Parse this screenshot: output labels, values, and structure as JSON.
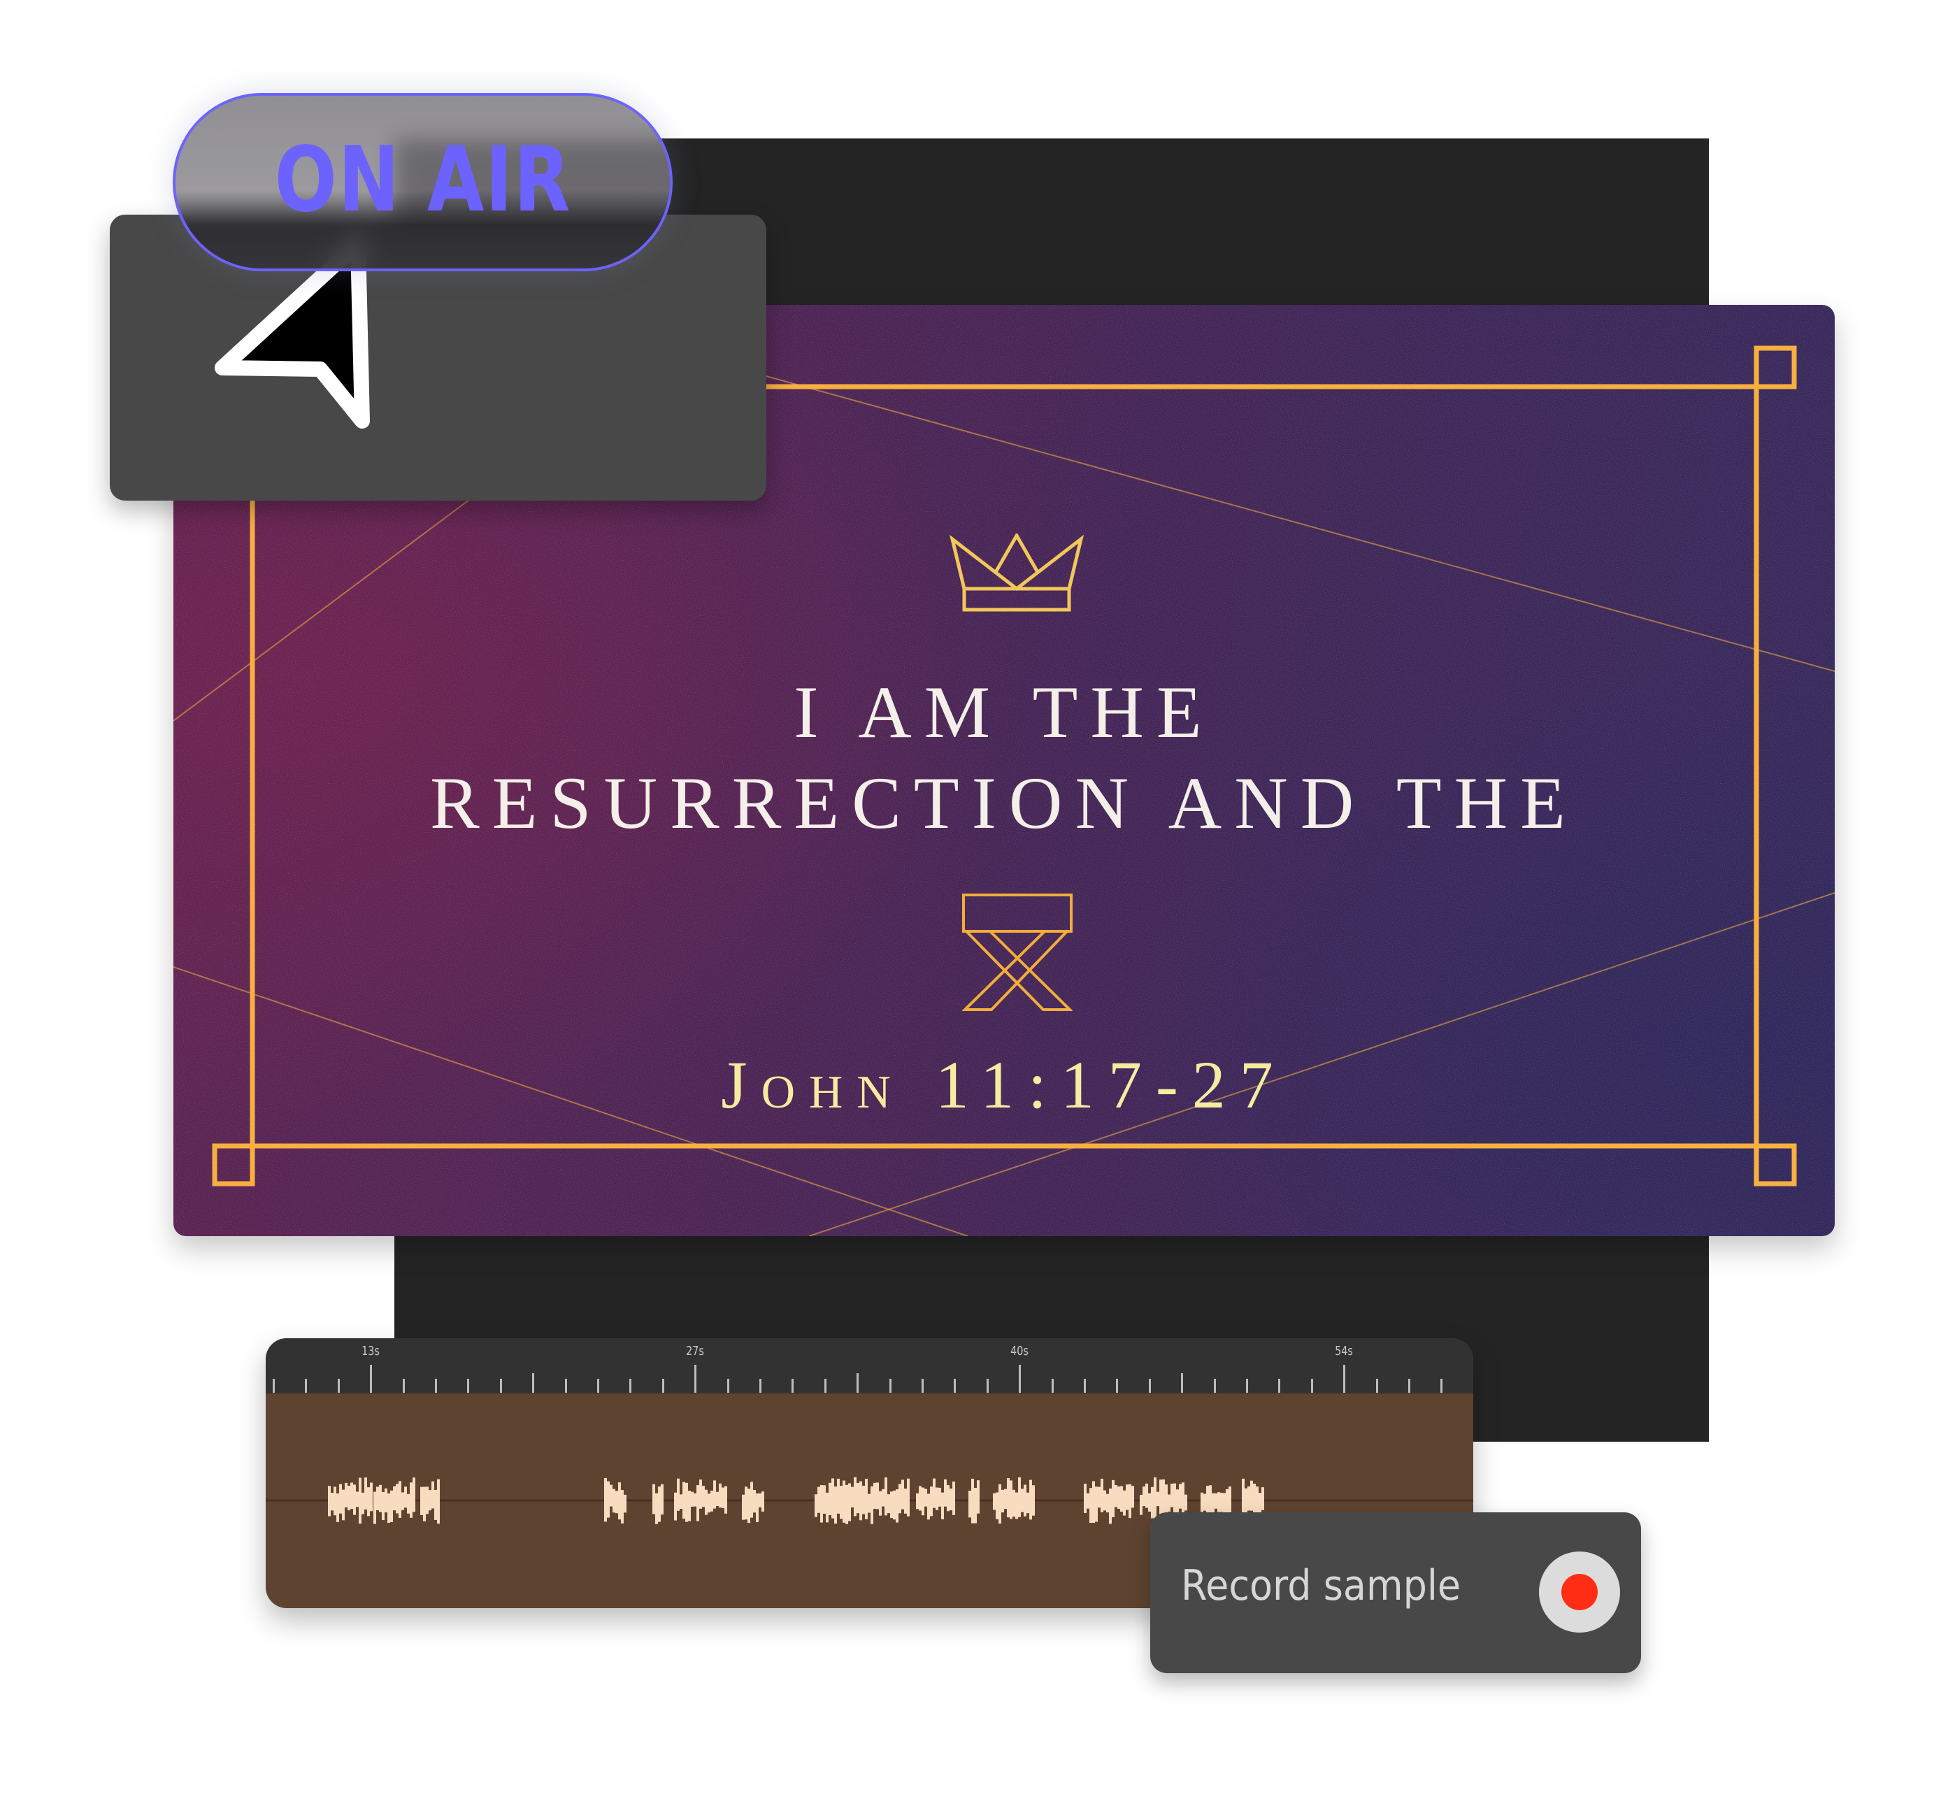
{
  "badge": {
    "label": "ON AIR",
    "color": "#6c63ff"
  },
  "slide": {
    "line1": "I AM THE",
    "line2": "RESURRECTION AND THE",
    "reference": "John 11:17-27",
    "icons": [
      "crown-icon",
      "manger-icon"
    ],
    "colors": {
      "gold": "#f7b040",
      "title": "#f4efe8",
      "reference": "#f6eca0",
      "left": "#5c2352",
      "right": "#33295c"
    }
  },
  "timeline": {
    "labels": [
      {
        "text": "13s",
        "tick": 3
      },
      {
        "text": "27s",
        "tick": 13
      },
      {
        "text": "40s",
        "tick": 23
      },
      {
        "text": "54s",
        "tick": 33
      }
    ],
    "tick_count": 38,
    "colors": {
      "ruler": "#323232",
      "track": "#5e4430",
      "wave": "#f7dcc0"
    }
  },
  "record": {
    "label": "Record sample",
    "dot_color": "#ff2d14"
  },
  "cursor": {
    "icon": "arrow-pointer-icon"
  }
}
